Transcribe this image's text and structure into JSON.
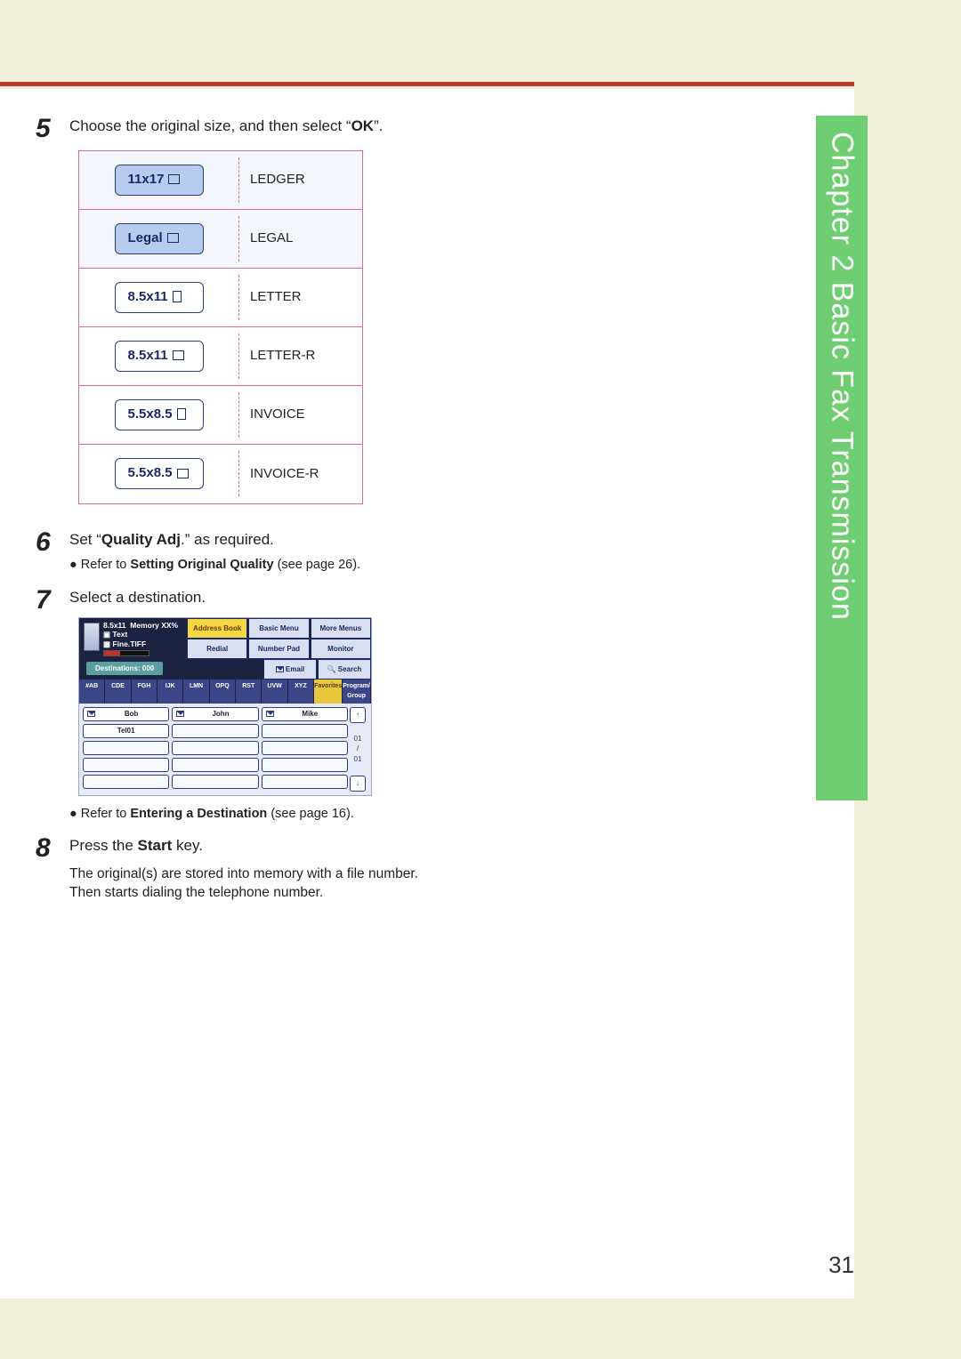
{
  "margin_tab": "Chapter 2   Basic Fax Transmission",
  "page_number": "31",
  "steps": {
    "5": {
      "text_before": "Choose the original size, and then select “",
      "bold": "OK",
      "text_after": "”."
    },
    "6": {
      "text_before": "Set “",
      "bold": "Quality Adj",
      "text_after": ".” as required.",
      "sub_prefix": "● Refer to ",
      "sub_bold": "Setting Original Quality",
      "sub_after": " (see page 26)."
    },
    "7": {
      "text": "Select a destination.",
      "sub_prefix": "● Refer to ",
      "sub_bold": "Entering a Destination",
      "sub_after": " (see page 16)."
    },
    "8": {
      "text_before": "Press the ",
      "bold": "Start",
      "text_after": " key.",
      "para": "The original(s) are stored into memory with a file number. Then starts dialing the telephone number."
    }
  },
  "size_rows": [
    {
      "btn": "11x17",
      "filled": true,
      "orient": "land",
      "label": "LEDGER"
    },
    {
      "btn": "Legal",
      "filled": true,
      "orient": "land",
      "label": "LEGAL"
    },
    {
      "btn": "8.5x11",
      "filled": false,
      "orient": "port",
      "label": "LETTER"
    },
    {
      "btn": "8.5x11",
      "filled": false,
      "orient": "land",
      "label": "LETTER-R"
    },
    {
      "btn": "5.5x8.5",
      "filled": false,
      "orient": "port",
      "label": "INVOICE"
    },
    {
      "btn": "5.5x8.5",
      "filled": false,
      "orient": "land",
      "label": "INVOICE-R"
    }
  ],
  "dest": {
    "header": {
      "size": "8.5x11",
      "memory": "Memory XX%",
      "mode": "Text",
      "quality": "Fine.TIFF"
    },
    "tabs_top": [
      "Address Book",
      "Basic Menu",
      "More Menus"
    ],
    "tabs_mid": [
      "Redial",
      "Number Pad",
      "Monitor"
    ],
    "tabs_bot": [
      "Email",
      "Search"
    ],
    "dest_label": "Destinations: 000",
    "alpha": [
      "#AB",
      "CDE",
      "FGH",
      "IJK",
      "LMN",
      "OPQ",
      "RST",
      "UVW",
      "XYZ",
      "Favorites",
      "Program/\nGroup"
    ],
    "contacts_row1": [
      "Bob",
      "John",
      "Mike"
    ],
    "contacts_row2": [
      "Tel01",
      "",
      ""
    ],
    "page_indicator": "01\n/\n01",
    "up": "↑",
    "down": "↓"
  }
}
